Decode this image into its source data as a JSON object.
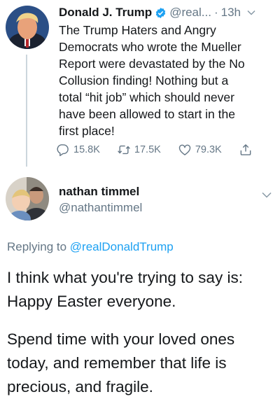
{
  "original_tweet": {
    "author_name": "Donald J. Trump",
    "handle": "@real...",
    "separator": "·",
    "time": "13h",
    "verified": true,
    "text": "The Trump Haters and Angry\nDemocrats who wrote the Mueller\nReport were devastated by the No\nCollusion finding! Nothing but a\ntotal “hit job” which should never\nhave been allowed to start in the\nfirst place!",
    "stats": {
      "replies": "15.8K",
      "retweets": "17.5K",
      "likes": "79.3K"
    },
    "icons": [
      "verified-badge-icon",
      "chevron-down-icon",
      "reply-icon",
      "retweet-icon",
      "like-icon",
      "share-icon"
    ]
  },
  "reply_tweet": {
    "author_name": "nathan timmel",
    "handle": "@nathantimmel",
    "replying_prefix": "Replying to",
    "replying_to": "@realDonaldTrump",
    "paragraph_1": "I think what you're trying to say is:\nHappy Easter everyone.",
    "paragraph_2": "Spend time with your loved ones\ntoday, and remember that life is\nprecious, and fragile."
  },
  "colors": {
    "text": "#14171a",
    "muted": "#657786",
    "link": "#1da1f2",
    "verified": "#1da1f2"
  }
}
